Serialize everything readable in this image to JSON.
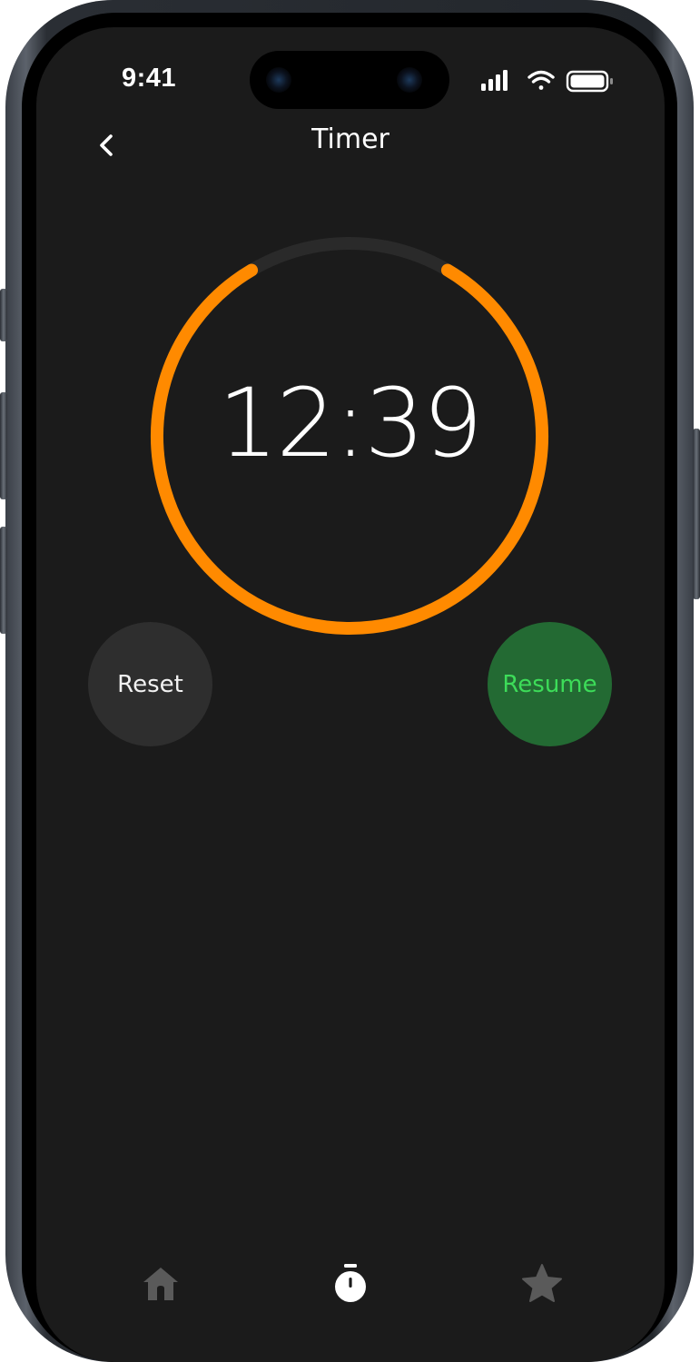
{
  "status_bar": {
    "time": "9:41",
    "icons": [
      "cellular-signal-icon",
      "wifi-icon",
      "battery-icon"
    ]
  },
  "nav": {
    "back_icon": "chevron-left-icon",
    "title": "Timer"
  },
  "timer": {
    "remaining": "12:39",
    "progress_fraction": 0.83,
    "progress_color": "#FF8A00",
    "track_color": "#2A2A2A"
  },
  "controls": {
    "reset_label": "Reset",
    "resume_label": "Resume",
    "reset_color": "#2E2E2E",
    "resume_color": "#236A33",
    "resume_text_color": "#3DDC59"
  },
  "tab_bar": {
    "tabs": [
      {
        "icon": "home-icon",
        "active": false
      },
      {
        "icon": "stopwatch-icon",
        "active": true
      },
      {
        "icon": "star-icon",
        "active": false
      }
    ]
  },
  "colors": {
    "background": "#1B1B1B",
    "accent": "#FF8A00"
  }
}
